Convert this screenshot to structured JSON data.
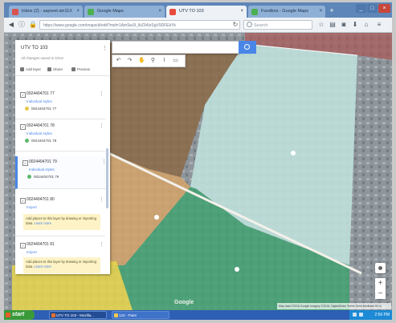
{
  "browser": {
    "tabs": [
      {
        "label": "Inbox (2) - aspreet.sin11X",
        "icon_color": "#d9534f"
      },
      {
        "label": "Google Maps",
        "icon_color": "#4caf50"
      },
      {
        "label": "UTV TO 103",
        "icon_color": "#e84b3c"
      },
      {
        "label": "Fundbox - Google Maps",
        "icon_color": "#4caf50"
      }
    ],
    "new_tab": "+",
    "url": "https://www.google.com/maps/d/edit?mid=1AmSw3I_lbZ94IzSgV9DFEkYk",
    "search_placeholder": "Search"
  },
  "map_panel": {
    "title": "UTV TO 103",
    "subtitle": "All changes saved in Drive",
    "actions": {
      "add_layer": "Add layer",
      "share": "Share",
      "preview": "Preview"
    },
    "layers": [
      {
        "name": "0024404701 77",
        "style": "Individual styles",
        "item": "0024404701 77",
        "dot": "#e8c84a"
      },
      {
        "name": "0024404701 78",
        "style": "Individual styles",
        "item": "0024404701 78",
        "dot": "#59b86a"
      },
      {
        "name": "0024404701 79",
        "style": "Individual styles",
        "item": "0024404701 79",
        "dot": "#59b86a"
      },
      {
        "name": "0024404701 80",
        "style": "Import",
        "note": "Add places to this layer by drawing or importing data.",
        "note_link": "Learn more"
      },
      {
        "name": "0024404701 81",
        "style": "Import",
        "note": "Add places to this layer by drawing or importing data.",
        "note_link": "Learn more"
      }
    ]
  },
  "map": {
    "google_logo": "Google",
    "footer": "Map data ©2016 Google Imagery ©2016, DigitalGlobe  Terms  Send feedback  50 m"
  },
  "taskbar": {
    "start": "start",
    "items": [
      {
        "label": "UTV TO 103 - Mozilla...",
        "icon": "#e8702a"
      },
      {
        "label": "123 - Paint",
        "icon": "#f2c94c"
      }
    ],
    "clock": "2:56 PM"
  }
}
